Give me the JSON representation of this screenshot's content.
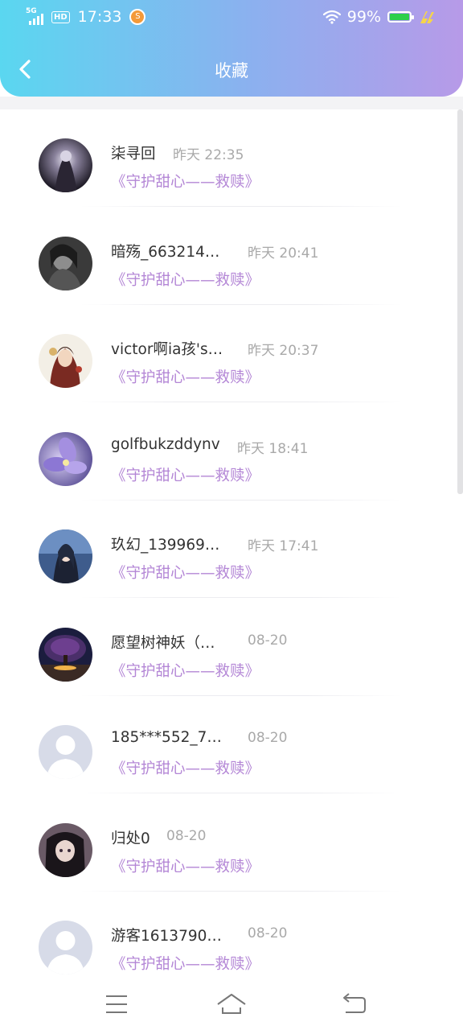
{
  "status_bar": {
    "network": "5G",
    "hd": "HD",
    "time": "17:33",
    "app_badge": "S",
    "battery": "99%",
    "battery_level": 0.99,
    "battery_color": "#2ccf4b"
  },
  "header": {
    "title": "收藏",
    "back_icon": "chevron-left-icon",
    "gradient": [
      "#5ad7f0",
      "#8cb0ef",
      "#b79ae8"
    ]
  },
  "accent_color": "#b487d6",
  "items": [
    {
      "name": "柒寻回",
      "time": "昨天 22:35",
      "work": "《守护甜心——救赎》",
      "avatar": "dark-fantasy-figure"
    },
    {
      "name": "暗殇_663214…",
      "time": "昨天 20:41",
      "work": "《守护甜心——救赎》",
      "avatar": "monochrome-portrait"
    },
    {
      "name": "victor啊ia孩's…",
      "time": "昨天 20:37",
      "work": "《守护甜心——救赎》",
      "avatar": "illustrated-girl"
    },
    {
      "name": "golfbukzddynv",
      "time": "昨天 18:41",
      "work": "《守护甜心——救赎》",
      "avatar": "purple-flower"
    },
    {
      "name": "玖幻_139969…",
      "time": "昨天 17:41",
      "work": "《守护甜心——救赎》",
      "avatar": "anime-character"
    },
    {
      "name": "愿望树神妖（…",
      "time": "08-20",
      "work": "《守护甜心——救赎》",
      "avatar": "glowing-tree"
    },
    {
      "name": "185***552_7…",
      "time": "08-20",
      "work": "《守护甜心——救赎》",
      "avatar": "default-avatar"
    },
    {
      "name": "归处0",
      "time": "08-20",
      "work": "《守护甜心——救赎》",
      "avatar": "anime-girl-dark-hair"
    },
    {
      "name": "游客1613790…",
      "time": "08-20",
      "work": "《守护甜心——救赎》",
      "avatar": "default-avatar"
    }
  ],
  "nav": {
    "menu_icon": "menu-icon",
    "home_icon": "home-icon",
    "back_icon": "return-icon"
  }
}
